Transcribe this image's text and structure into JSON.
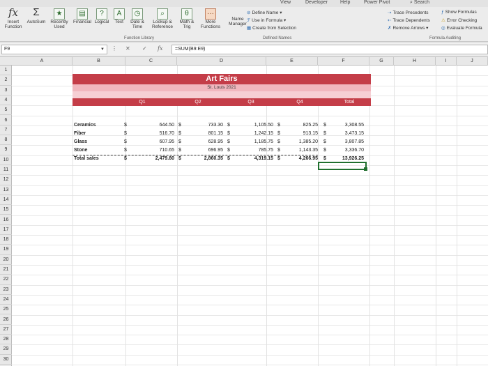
{
  "ribbon": {
    "tabs": [
      "View",
      "Developer",
      "Help",
      "Power Pivot",
      "Search"
    ],
    "insert_function_label": "Insert\nFunction",
    "buttons": [
      {
        "label": "AutoSum",
        "icon": "sigma-icon"
      },
      {
        "label": "Recently\nUsed",
        "icon": "star-icon"
      },
      {
        "label": "Financial",
        "icon": "book-icon"
      },
      {
        "label": "Logical",
        "icon": "question-icon"
      },
      {
        "label": "Text",
        "icon": "text-a-icon"
      },
      {
        "label": "Date &\nTime",
        "icon": "clock-icon"
      },
      {
        "label": "Lookup &\nReference",
        "icon": "magnifier-icon"
      },
      {
        "label": "Math &\nTrig",
        "icon": "theta-icon"
      },
      {
        "label": "More\nFunctions",
        "icon": "more-icon"
      }
    ],
    "function_library_label": "Function Library",
    "name_manager_label": "Name\nManager",
    "define_name": "Define Name",
    "use_in_formula": "Use in Formula",
    "create_from_selection": "Create from Selection",
    "defined_names_label": "Defined Names",
    "trace_precedents": "Trace Precedents",
    "trace_dependents": "Trace Dependents",
    "remove_arrows": "Remove Arrows",
    "show_formulas": "Show Formulas",
    "error_checking": "Error Checking",
    "evaluate_formula": "Evaluate Formula",
    "formula_auditing_label": "Formula Auditing"
  },
  "formula_bar": {
    "name_box": "F9",
    "cancel_symbol": "✕",
    "enter_symbol": "✓",
    "fx_symbol": "fx",
    "formula": "=SUM(B9:E9)"
  },
  "columns": [
    "A",
    "B",
    "C",
    "D",
    "E",
    "F",
    "G",
    "H",
    "I",
    "J"
  ],
  "rows": [
    "1",
    "2",
    "3",
    "4",
    "5",
    "6",
    "7",
    "8",
    "9",
    "10",
    "11",
    "12",
    "13",
    "14",
    "15",
    "16",
    "17",
    "18",
    "19",
    "20",
    "21",
    "22",
    "23",
    "24",
    "25",
    "26",
    "27",
    "28",
    "29",
    "30"
  ],
  "sheet": {
    "title": "Art Fairs",
    "subtitle": "St. Louis 2021",
    "headers": [
      "Q1",
      "Q2",
      "Q3",
      "Q4",
      "Total"
    ],
    "currency": "$",
    "data_rows": [
      {
        "label": "Ceramics",
        "values": [
          "644.50",
          "733.30",
          "1,105.50",
          "825.25",
          "3,308.55"
        ]
      },
      {
        "label": "Fiber",
        "values": [
          "516.70",
          "801.15",
          "1,242.15",
          "913.15",
          "3,473.15"
        ]
      },
      {
        "label": "Glass",
        "values": [
          "607.95",
          "628.95",
          "1,185.75",
          "1,385.20",
          "3,807.85"
        ]
      },
      {
        "label": "Stone",
        "values": [
          "710.65",
          "696.95",
          "785.75",
          "1,143.35",
          "3,336.70"
        ]
      }
    ],
    "total_row": {
      "label": "Total sales",
      "values": [
        "2,479.80",
        "2,860.35",
        "4,319.15",
        "4,266.95",
        "13,926.25"
      ]
    }
  }
}
